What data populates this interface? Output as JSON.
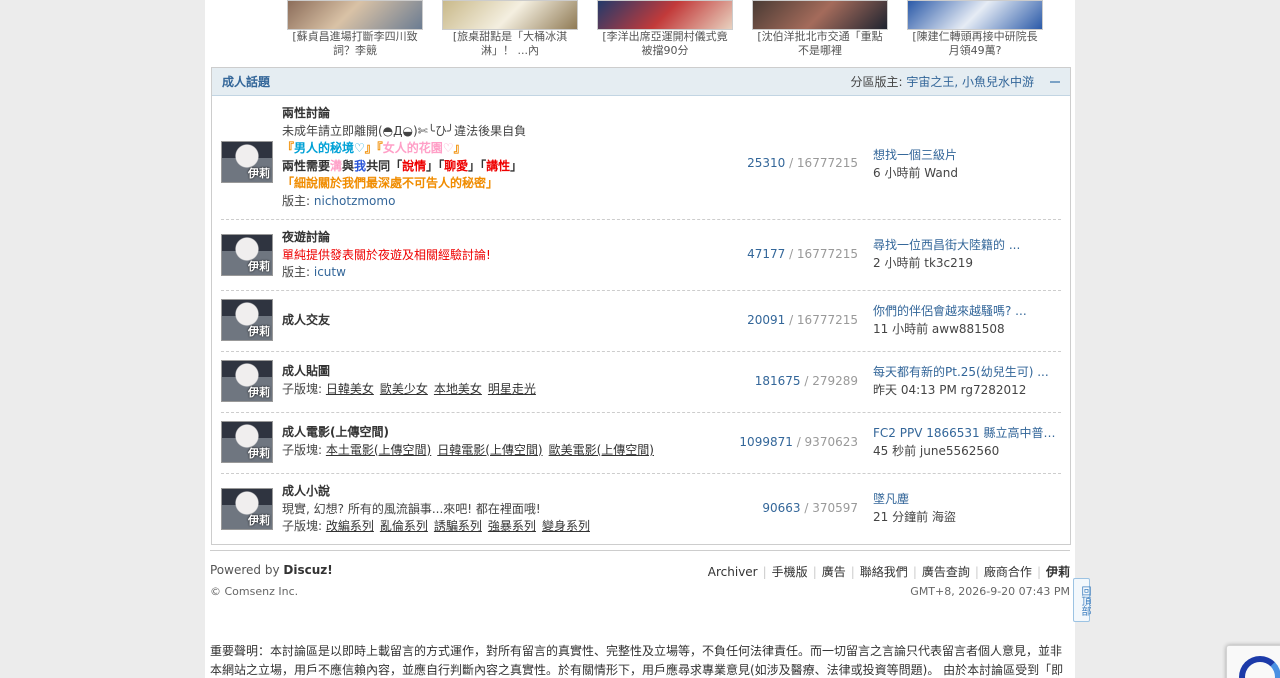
{
  "thumbs": [
    {
      "caption": "[蘇貞昌進場打斷李四川致詞？李競"
    },
    {
      "caption": "[旅桌甜點是「大桶冰淇淋」！ ...內"
    },
    {
      "caption": "[李洋出席亞運開村儀式竟被擋90分"
    },
    {
      "caption": "[沈伯洋批北市交通「重點不是哪裡"
    },
    {
      "caption": "[陳建仁轉頭再接中研院長月領49萬?"
    }
  ],
  "board": {
    "title": "成人話題",
    "mods_label": "分區版主:",
    "mods": "宇宙之王, 小魚兒水中游"
  },
  "avatar_text": "伊莉",
  "forums": [
    {
      "name": "兩性討論",
      "line1": "未成年請立即離開(◓Д◒)✄╰ひ╯違法後果自負",
      "line2_a": "『",
      "line2_b": "男人的秘境♡",
      "line2_c": "』『",
      "line2_d": "女人的花園♡",
      "line2_e": "』",
      "line3_a": "兩性需要",
      "line3_b": "溝",
      "line3_c": "與",
      "line3_d": "我",
      "line3_e": "共同「",
      "line3_f": "說情",
      "line3_g": "」「",
      "line3_h": "聊愛",
      "line3_i": "」「",
      "line3_j": "講性",
      "line3_k": "」",
      "line4_a": "「",
      "line4_b": "細說關於我們最深處不可告人的秘密",
      "line4_c": "」",
      "mod_label": "版主:",
      "mod": "nichotzmomo",
      "threads": "25310",
      "posts": "16777215",
      "last_title": "想找一個三級片",
      "last_meta": "6 小時前 Wand"
    },
    {
      "name": "夜遊討論",
      "desc": "單純提供發表關於夜遊及相關經驗討論!",
      "mod_label": "版主:",
      "mod": "icutw",
      "threads": "47177",
      "posts": "16777215",
      "last_title": "尋找一位西昌街大陸籍的 ...",
      "last_meta": "2 小時前 tk3c219"
    },
    {
      "name": "成人交友",
      "threads": "20091",
      "posts": "16777215",
      "last_title": "你們的伴侶會越來越騷嗎? ...",
      "last_meta": "11 小時前 aww881508"
    },
    {
      "name": "成人貼圖",
      "sub_label": "子版塊:",
      "subs": [
        "日韓美女",
        "歐美少女",
        "本地美女",
        "明星走光"
      ],
      "threads": "181675",
      "posts": "279289",
      "last_title": "每天都有新的Pt.25(幼兒生可) ...",
      "last_meta": "昨天 04:13 PM rg7282012"
    },
    {
      "name": "成人電影(上傳空間)",
      "sub_label": "子版塊:",
      "subs": [
        "本土電影(上傳空間)",
        "日韓電影(上傳空間)",
        "歐美電影(上傳空間)"
      ],
      "threads": "1099871",
      "posts": "9370623",
      "last_title": "FC2 PPV 1866531 縣立高中普通...",
      "last_meta": "45 秒前 june5562560"
    },
    {
      "name": "成人小說",
      "desc": "現實, 幻想? 所有的風流韻事...來吧! 都在裡面哦!",
      "sub_label": "子版塊:",
      "subs": [
        "改編系列",
        "亂倫系列",
        "誘騙系列",
        "強暴系列",
        "變身系列"
      ],
      "threads": "90663",
      "posts": "370597",
      "last_title": "墜凡塵",
      "last_meta": "21 分鐘前 海盜"
    }
  ],
  "footer": {
    "powered": "Powered by",
    "discuz": "Discuz!",
    "copyright": "© Comsenz Inc.",
    "links": [
      "Archiver",
      "手機版",
      "廣告",
      "聯絡我們",
      "廣告查詢",
      "廠商合作"
    ],
    "brand": "伊莉",
    "gmt": "GMT+8, 2026-9-20 07:43 PM"
  },
  "notice": "重要聲明：本討論區是以即時上載留言的方式運作，對所有留言的真實性、完整性及立場等，不負任何法律責任。而一切留言之言論只代表留言者個人意見，並非本網站之立場，用戶不應信賴內容，並應自行判斷內容之真實性。於有關情形下，用戶應尋求專業意見(如涉及醫療、法律或投資等問題)。 由於本討論區受到「即時上載留",
  "to_top": "回頂部"
}
